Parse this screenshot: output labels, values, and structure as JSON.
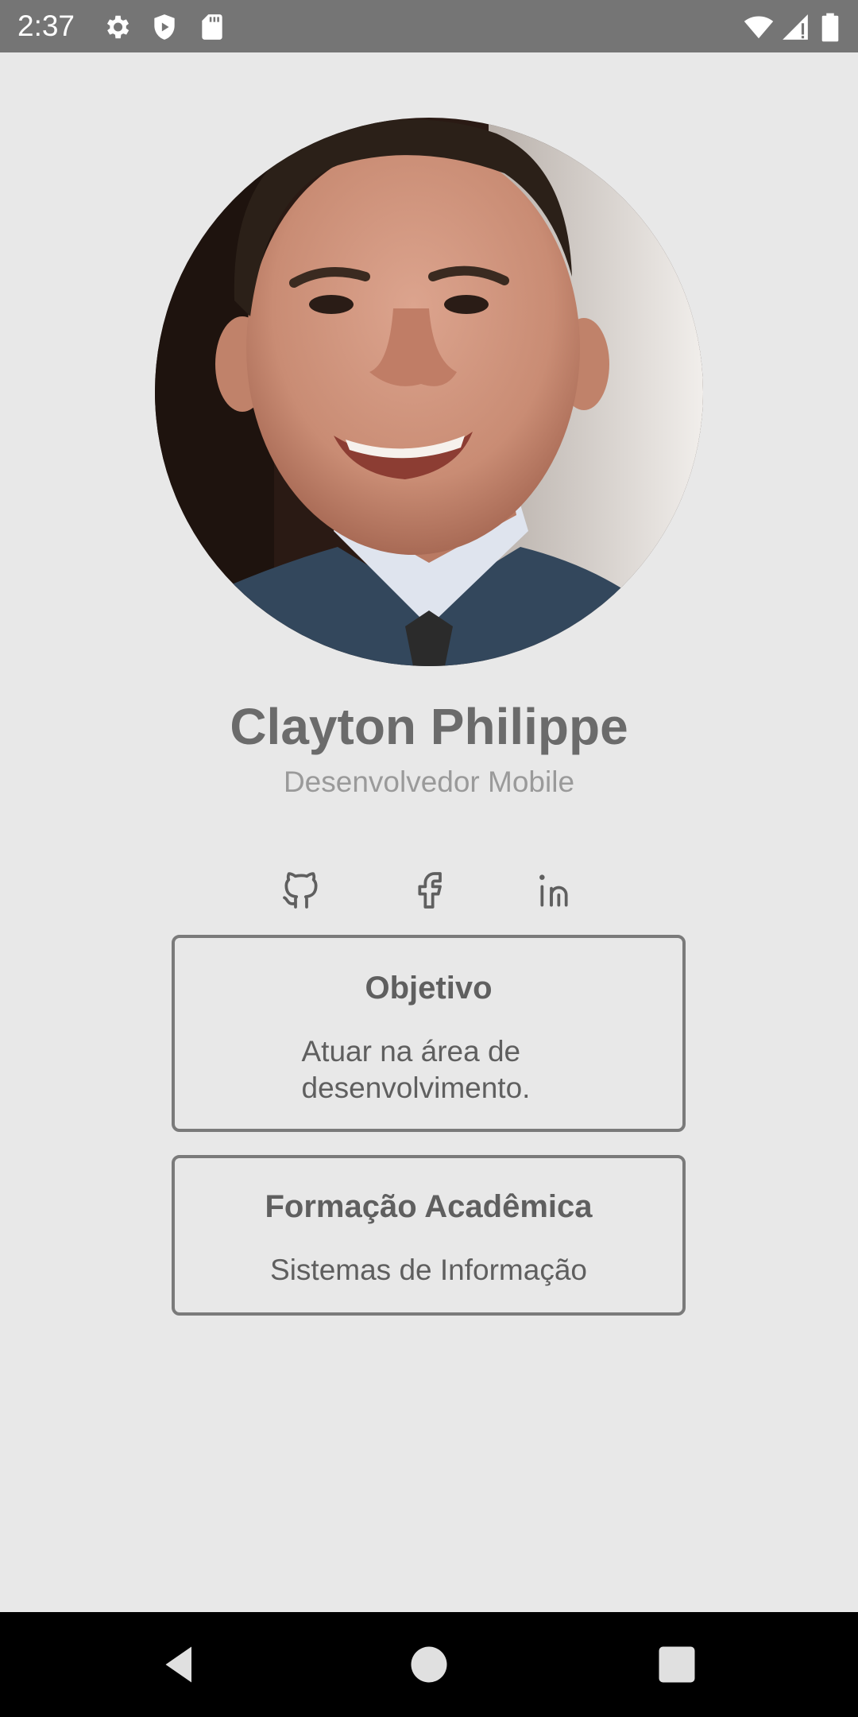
{
  "status_bar": {
    "time": "2:37",
    "icons": [
      "gear-icon",
      "shield-icon",
      "sd-card-icon",
      "wifi-icon",
      "signal-icon",
      "battery-icon"
    ],
    "background": "#757575"
  },
  "profile": {
    "photo": "profile-photo",
    "name": "Clayton Philippe",
    "role": "Desenvolvedor Mobile"
  },
  "social": [
    "github-icon",
    "facebook-icon",
    "linkedin-icon"
  ],
  "cards": {
    "objective": {
      "title": "Objetivo",
      "text": "Atuar na área de desenvolvimento."
    },
    "education": {
      "title": "Formação Acadêmica",
      "text": "Sistemas de Informação"
    }
  },
  "nav_bar": {
    "buttons": [
      "back-icon",
      "home-icon",
      "recents-icon"
    ]
  },
  "colors": {
    "background": "#e8e8e8",
    "text_primary": "#6b6b6b",
    "text_secondary": "#9a9a9a",
    "card_border": "#7a7a7a"
  }
}
